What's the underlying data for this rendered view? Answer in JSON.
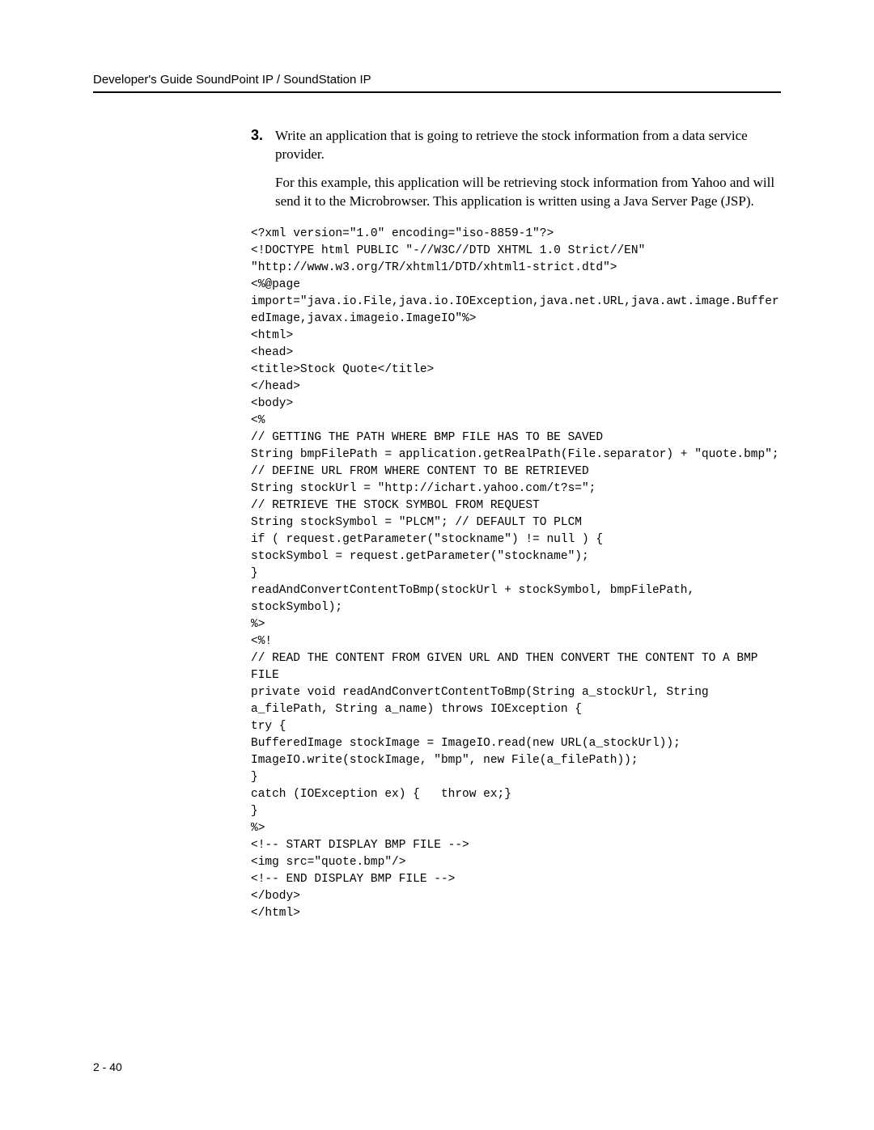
{
  "header": "Developer's Guide SoundPoint IP / SoundStation IP",
  "pageNumber": "2 - 40",
  "step": {
    "number": "3.",
    "text": "Write an application that is going to retrieve the stock information from a data service provider."
  },
  "subpara": "For this example, this application will be retrieving stock information from Yahoo and will send it to the Microbrowser. This application is written using a Java Server Page (JSP).",
  "code": "<?xml version=\"1.0\" encoding=\"iso-8859-1\"?>\n<!DOCTYPE html PUBLIC \"-//W3C//DTD XHTML 1.0 Strict//EN\" \"http://www.w3.org/TR/xhtml1/DTD/xhtml1-strict.dtd\">\n<%@page\nimport=\"java.io.File,java.io.IOException,java.net.URL,java.awt.image.BufferedImage,javax.imageio.ImageIO\"%>\n<html>\n<head>\n<title>Stock Quote</title>\n</head>\n<body>\n<%\n// GETTING THE PATH WHERE BMP FILE HAS TO BE SAVED\nString bmpFilePath = application.getRealPath(File.separator) + \"quote.bmp\";\n// DEFINE URL FROM WHERE CONTENT TO BE RETRIEVED\nString stockUrl = \"http://ichart.yahoo.com/t?s=\";\n// RETRIEVE THE STOCK SYMBOL FROM REQUEST\nString stockSymbol = \"PLCM\"; // DEFAULT TO PLCM\nif ( request.getParameter(\"stockname\") != null ) {\nstockSymbol = request.getParameter(\"stockname\");\n}\nreadAndConvertContentToBmp(stockUrl + stockSymbol, bmpFilePath, stockSymbol);\n%>\n<%!\n// READ THE CONTENT FROM GIVEN URL AND THEN CONVERT THE CONTENT TO A BMP FILE\nprivate void readAndConvertContentToBmp(String a_stockUrl, String a_filePath, String a_name) throws IOException {\ntry {\nBufferedImage stockImage = ImageIO.read(new URL(a_stockUrl));\nImageIO.write(stockImage, \"bmp\", new File(a_filePath));\n}\ncatch (IOException ex) {   throw ex;}\n}\n%>\n<!-- START DISPLAY BMP FILE -->\n<img src=\"quote.bmp\"/>\n<!-- END DISPLAY BMP FILE -->\n</body>\n</html>"
}
